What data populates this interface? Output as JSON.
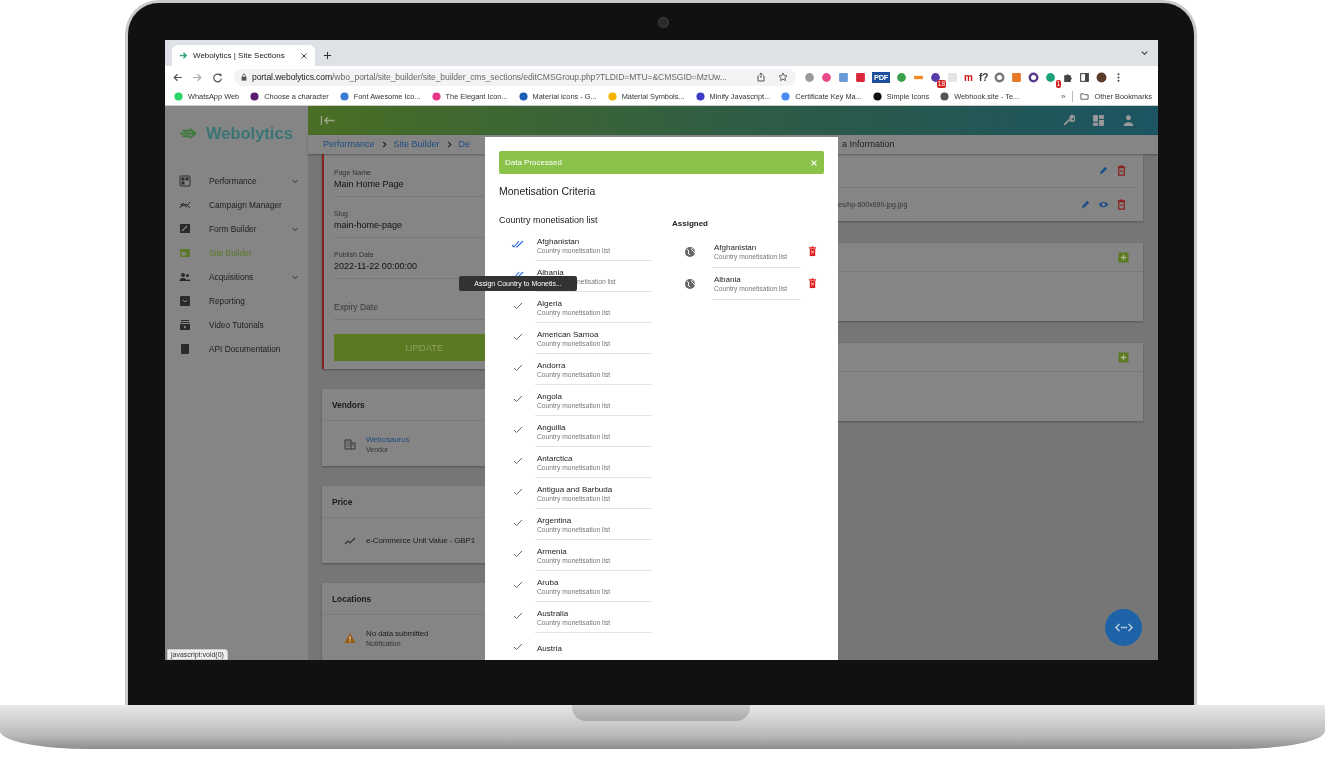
{
  "browser": {
    "tab": {
      "title": "Webolytics | Site Sections",
      "selected": true
    },
    "url_host": "portal.webolytics.com",
    "url_path": "/wbo_portal/site_builder/site_builder_cms_sections/editCMSGroup.php?TLDID=MTU=&CMSGID=MzUw...",
    "extensions": [
      {
        "kind": "dot",
        "color": "#9a9a9a"
      },
      {
        "kind": "dot",
        "color": "#e84a8a"
      },
      {
        "kind": "square",
        "color": "#6a9ad8"
      },
      {
        "kind": "square",
        "color": "#d8283a"
      },
      {
        "kind": "tile",
        "color": "#1f4f9a",
        "label": "PDF"
      },
      {
        "kind": "dot",
        "color": "#3aa04a"
      },
      {
        "kind": "bar",
        "color": "#f08a20"
      },
      {
        "kind": "badged",
        "color": "#5a3aa8",
        "label": "18"
      },
      {
        "kind": "square",
        "color": "#e4e4e4"
      },
      {
        "kind": "glyph",
        "color": "#d01010",
        "label": "m"
      },
      {
        "kind": "glyph",
        "color": "#333333",
        "label": "f?"
      },
      {
        "kind": "ring",
        "color": "#777777"
      },
      {
        "kind": "square",
        "color": "#e8782a"
      },
      {
        "kind": "ring",
        "color": "#5a3a8a"
      },
      {
        "kind": "badged",
        "color": "#1aa07a",
        "label": "1"
      }
    ],
    "bookmarks": [
      {
        "label": "WhatsApp Web",
        "color": "#25d366"
      },
      {
        "label": "Choose a character",
        "color": "#5a1d6e"
      },
      {
        "label": "Font Awesome Ico...",
        "color": "#3a7bd5"
      },
      {
        "label": "The Elegant Icon...",
        "color": "#e8388a"
      },
      {
        "label": "Material icons - G...",
        "color": "#1a5fb4"
      },
      {
        "label": "Material Symbols...",
        "color": "#f4b400"
      },
      {
        "label": "Minify Javascript...",
        "color": "#3c3cc8"
      },
      {
        "label": "Certificate Key Ma...",
        "color": "#4a8af4"
      },
      {
        "label": "Simple Icons",
        "color": "#111111"
      },
      {
        "label": "Webhook.site - Te...",
        "color": "#555555"
      }
    ],
    "bookmarks_overflow": "»",
    "other_bookmarks": "Other Bookmarks",
    "status_link": "javascript:void(0)"
  },
  "sidebar": {
    "logo": "Webolytics",
    "items": [
      {
        "label": "Performance",
        "selected": false,
        "expandable": true
      },
      {
        "label": "Campaign Manager",
        "selected": false,
        "expandable": false
      },
      {
        "label": "Form Builder",
        "selected": false,
        "expandable": true
      },
      {
        "label": "Site Builder",
        "selected": true,
        "expandable": false
      },
      {
        "label": "Acquisitions",
        "selected": false,
        "expandable": true
      },
      {
        "label": "Reporting",
        "selected": false,
        "expandable": false
      },
      {
        "label": "Video Tutorials",
        "selected": false,
        "expandable": false
      },
      {
        "label": "API Documentation",
        "selected": false,
        "expandable": false
      }
    ]
  },
  "breadcrumbs": [
    "Performance",
    "Site Builder",
    "De"
  ],
  "breadcrumb_tail": "a Information",
  "page_form": {
    "fields": [
      {
        "label": "Page Name",
        "value": "Main Home Page"
      },
      {
        "label": "Slug",
        "value": "main-home-page"
      },
      {
        "label": "Publish Date",
        "value": "2022-11-22 00:00:00"
      },
      {
        "placeholder": "Expiry Date"
      }
    ],
    "button": "UPDATE"
  },
  "cards": [
    {
      "title": "Vendors",
      "kind": "link",
      "name": "Webosaurus",
      "sub": "Vendor"
    },
    {
      "title": "Price",
      "kind": "trend",
      "name": "e-Commerce Unit Value - GBP1"
    },
    {
      "title": "Locations",
      "kind": "warning",
      "name": "No data submitted",
      "sub": "Notification"
    }
  ],
  "media_path": "es/hp-600x690-jpg.jpg",
  "modal": {
    "alert": "Data Processed",
    "title": "Monetisation Criteria",
    "list_title": "Country monetisation list",
    "countries": [
      {
        "name": "Afghanistan",
        "sub": "Country monetisation list",
        "assigned": true
      },
      {
        "name": "Albania",
        "sub": "netisation list",
        "assigned": true,
        "tooltip": "Assign Country to Monetis..."
      },
      {
        "name": "Algeria",
        "sub": "Country monetisation list",
        "assigned": false
      },
      {
        "name": "American Samoa",
        "sub": "Country monetisation list",
        "assigned": false
      },
      {
        "name": "Andorra",
        "sub": "Country monetisation list",
        "assigned": false
      },
      {
        "name": "Angola",
        "sub": "Country monetisation list",
        "assigned": false
      },
      {
        "name": "Anguilla",
        "sub": "Country monetisation list",
        "assigned": false
      },
      {
        "name": "Antarctica",
        "sub": "Country monetisation list",
        "assigned": false
      },
      {
        "name": "Antigua and Barbuda",
        "sub": "Country monetisation list",
        "assigned": false
      },
      {
        "name": "Argentina",
        "sub": "Country monetisation list",
        "assigned": false
      },
      {
        "name": "Armenia",
        "sub": "Country monetisation list",
        "assigned": false
      },
      {
        "name": "Aruba",
        "sub": "Country monetisation list",
        "assigned": false
      },
      {
        "name": "Australia",
        "sub": "Country monetisation list",
        "assigned": false
      },
      {
        "name": "Austria",
        "assigned": false
      }
    ],
    "assigned_title": "Assigned",
    "assigned": [
      {
        "name": "Afghanistan",
        "sub": "Country monetisation list"
      },
      {
        "name": "Albania",
        "sub": "Country monetisation list"
      }
    ]
  }
}
